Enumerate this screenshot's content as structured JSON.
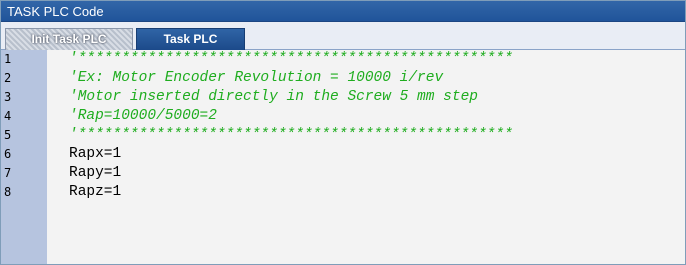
{
  "window": {
    "title": "TASK PLC Code"
  },
  "tabs": [
    {
      "label": "Init Task PLC",
      "active": false
    },
    {
      "label": "Task PLC",
      "active": true
    }
  ],
  "editor": {
    "lines": [
      {
        "no": "1",
        "text": "'**************************************************",
        "kind": "comment"
      },
      {
        "no": "2",
        "text": "'Ex: Motor Encoder Revolution = 10000 i/rev",
        "kind": "comment"
      },
      {
        "no": "3",
        "text": "'Motor inserted directly in the Screw 5 mm step",
        "kind": "comment"
      },
      {
        "no": "4",
        "text": "'Rap=10000/5000=2",
        "kind": "comment"
      },
      {
        "no": "5",
        "text": "'**************************************************",
        "kind": "comment"
      },
      {
        "no": "6",
        "text": "Rapx=1",
        "kind": "plain"
      },
      {
        "no": "7",
        "text": "Rapy=1",
        "kind": "plain"
      },
      {
        "no": "8",
        "text": "Rapz=1",
        "kind": "plain"
      }
    ]
  },
  "colors": {
    "title_bar": "#2a5fa3",
    "gutter": "#b6c4df",
    "comment": "#1fad1f",
    "editor_bg": "#f3f3f3"
  }
}
